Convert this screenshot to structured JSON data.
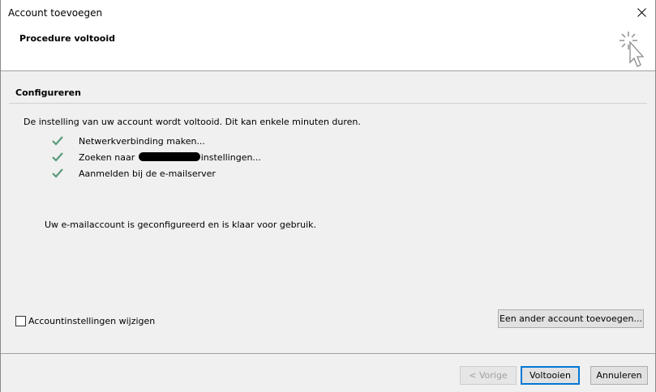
{
  "window": {
    "title": "Account toevoegen"
  },
  "header": {
    "title": "Procedure voltooid"
  },
  "section": {
    "title": "Configureren"
  },
  "intro_text": "De instelling van uw account wordt voltooid. Dit kan enkele minuten duren.",
  "steps": [
    {
      "text": "Netwerkverbinding maken...",
      "status": "done"
    },
    {
      "text_before": "Zoeken naar ",
      "text_after": "instellingen...",
      "status": "done"
    },
    {
      "text": "Aanmelden bij de e-mailserver",
      "status": "done"
    }
  ],
  "done_message": "Uw e-mailaccount is geconfigureerd en is klaar voor gebruik.",
  "options": {
    "change_settings_label": "Accountinstellingen wijzigen",
    "change_settings_checked": false,
    "add_another_label": "Een ander account toevoegen..."
  },
  "footer": {
    "back_label": "< Vorige",
    "finish_label": "Voltooien",
    "cancel_label": "Annuleren"
  },
  "colors": {
    "check": "#5b9a7a",
    "accent": "#0078d7"
  }
}
